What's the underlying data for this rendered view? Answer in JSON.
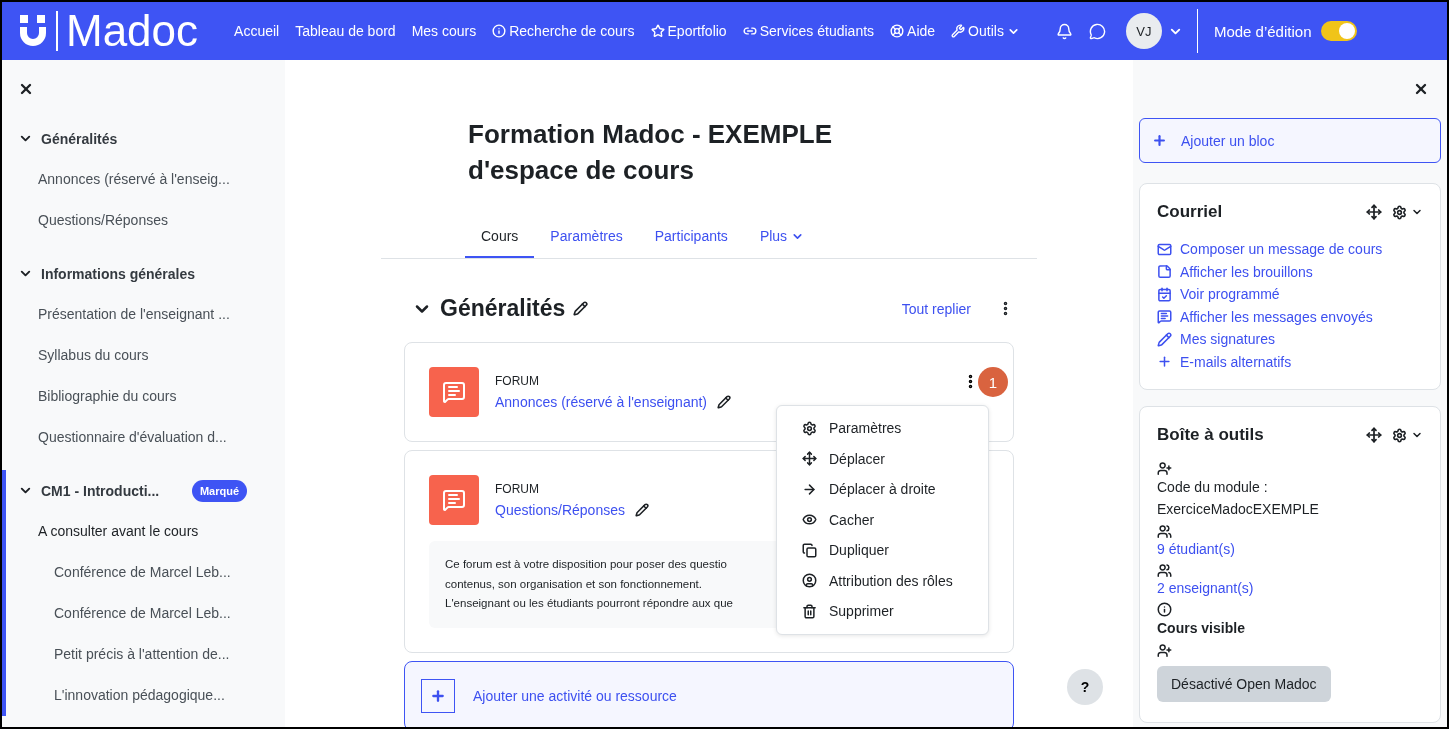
{
  "navbar": {
    "logo": "Madoc",
    "links": [
      {
        "label": "Accueil"
      },
      {
        "label": "Tableau de bord"
      },
      {
        "label": "Mes cours"
      },
      {
        "label": "Recherche de cours"
      },
      {
        "label": "Eportfolio"
      },
      {
        "label": "Services étudiants"
      },
      {
        "label": "Aide"
      },
      {
        "label": "Outils",
        "dropdown": true
      }
    ],
    "avatar": "VJ",
    "edit_mode": {
      "label": "Mode d’édition",
      "on": true
    }
  },
  "course_index": {
    "sections": [
      {
        "title": "Généralités",
        "expanded": true,
        "highlighted": false,
        "children": [
          {
            "label": "Annonces (réservé à l'enseig..."
          },
          {
            "label": "Questions/Réponses"
          }
        ]
      },
      {
        "title": "Informations générales",
        "expanded": true,
        "highlighted": false,
        "children": [
          {
            "label": "Présentation de l'enseignant ..."
          },
          {
            "label": "Syllabus du cours"
          },
          {
            "label": "Bibliographie du cours"
          },
          {
            "label": "Questionnaire d'évaluation d..."
          }
        ]
      },
      {
        "title": "CM1 - Introducti...",
        "badge": "Marqué",
        "expanded": true,
        "highlighted": true,
        "children": [
          {
            "label": "A consulter avant le cours",
            "children": [
              {
                "label": "Conférence de Marcel Leb..."
              },
              {
                "label": "Conférence de Marcel Leb..."
              },
              {
                "label": "Petit précis à l'attention de..."
              },
              {
                "label": "L'innovation pédagogique..."
              }
            ]
          }
        ]
      }
    ]
  },
  "course": {
    "title": "Formation Madoc - EXEMPLE d'espace de cours",
    "tabs": [
      {
        "label": "Cours",
        "selected": true
      },
      {
        "label": "Paramètres",
        "selected": false
      },
      {
        "label": "Participants",
        "selected": false
      },
      {
        "label": "Plus",
        "selected": false,
        "dropdown": true
      }
    ],
    "section": {
      "title": "Généralités",
      "expanded": true,
      "collapse_all": "Tout replier",
      "activities": [
        {
          "type": "FORUM",
          "name": "Annonces (réservé à l'enseignant)",
          "badge": "1",
          "menu": [
            "Paramètres",
            "Déplacer",
            "Déplacer à droite",
            "Cacher",
            "Dupliquer",
            "Attribution des rôles",
            "Supprimer"
          ]
        },
        {
          "type": "FORUM",
          "name": "Questions/Réponses",
          "description": [
            "Ce forum est à votre disposition pour poser des questio",
            "contenus, son organisation et son fonctionnement.",
            "L'enseignant ou les étudiants pourront répondre aux que"
          ]
        }
      ],
      "add_activity": "Ajouter une activité ou ressource"
    },
    "help": "?"
  },
  "blocks": {
    "add_block": "Ajouter un bloc",
    "courriel": {
      "title": "Courriel",
      "links": [
        "Composer un message de cours",
        "Afficher les brouillons",
        "Voir programmé",
        "Afficher les messages envoyés",
        "Mes signatures",
        "E-mails alternatifs"
      ]
    },
    "toolbox": {
      "title": "Boîte à outils",
      "items": [
        {
          "kind": "text",
          "lines": [
            "Code du module :",
            "ExerciceMadocEXEMPLE"
          ]
        },
        {
          "kind": "link",
          "lines": [
            "9 étudiant(s)"
          ]
        },
        {
          "kind": "link",
          "lines": [
            "2 enseignant(s)"
          ]
        },
        {
          "kind": "bold",
          "lines": [
            "Cours visible"
          ]
        },
        {
          "kind": "button",
          "lines": [
            "Désactivé Open Madoc"
          ]
        }
      ]
    }
  }
}
